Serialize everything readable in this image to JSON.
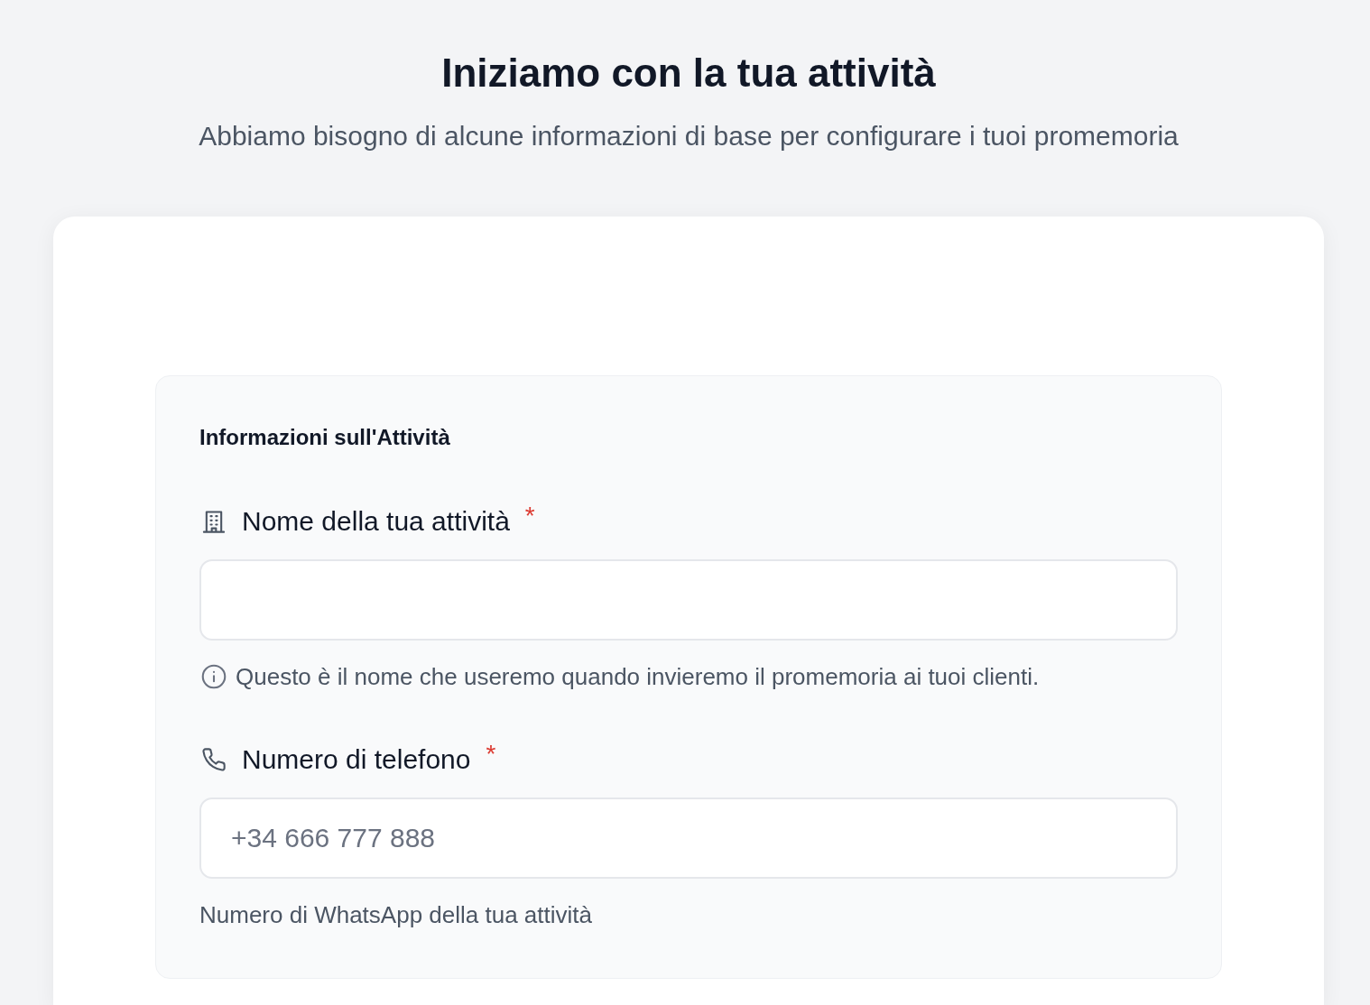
{
  "header": {
    "title": "Iniziamo con la tua attività",
    "subtitle": "Abbiamo bisogno di alcune informazioni di base per configurare i tuoi promemoria"
  },
  "section": {
    "title": "Informazioni sull'Attività",
    "fields": [
      {
        "kind": "text",
        "label": "Nome della tua attività",
        "required_mark": "*",
        "help": {
          "kind": "info",
          "text": "Questo è il nome che useremo quando invieremo il promemoria ai tuoi clienti."
        }
      },
      {
        "kind": "tel",
        "label": "Numero di telefono",
        "required_mark": "*",
        "placeholder": "+34 666 777 888",
        "help": {
          "kind": "plain",
          "text": "Numero di WhatsApp della tua attività"
        }
      }
    ]
  }
}
